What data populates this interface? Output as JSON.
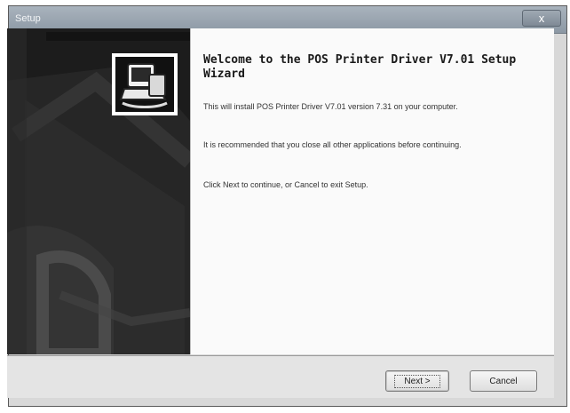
{
  "window": {
    "title": "Setup",
    "close_glyph": "x"
  },
  "sidebar": {
    "logo": "installer-computer-icon"
  },
  "content": {
    "heading": "Welcome to the POS Printer Driver V7.01 Setup Wizard",
    "paragraph1": "This will install POS Printer Driver V7.01 version 7.31 on your computer.",
    "paragraph2": "It is recommended that you close all other applications before continuing.",
    "paragraph3": "Click Next to continue, or Cancel to exit Setup."
  },
  "buttons": {
    "next": "Next >",
    "cancel": "Cancel"
  }
}
